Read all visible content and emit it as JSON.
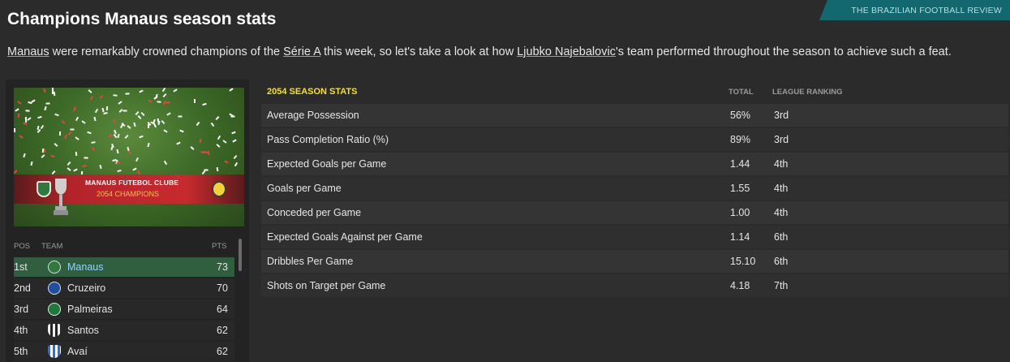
{
  "header": {
    "title": "Champions Manaus season stats",
    "source": "THE BRAZILIAN FOOTBALL REVIEW"
  },
  "intro": {
    "part1": "Manaus",
    "part2": " were remarkably crowned champions of the ",
    "part3": "Série A",
    "part4": " this week, so let's take a look at how ",
    "part5": "Ljubko Najebalovic",
    "part6": "'s team performed throughout the season to achieve such a feat."
  },
  "banner": {
    "club": "MANAUS FUTEBOL CLUBE",
    "subtitle": "2054 CHAMPIONS"
  },
  "standings": {
    "headers": {
      "pos": "POS",
      "team": "TEAM",
      "pts": "PTS"
    },
    "rows": [
      {
        "pos": "1st",
        "team": "Manaus",
        "pts": "73"
      },
      {
        "pos": "2nd",
        "team": "Cruzeiro",
        "pts": "70"
      },
      {
        "pos": "3rd",
        "team": "Palmeiras",
        "pts": "64"
      },
      {
        "pos": "4th",
        "team": "Santos",
        "pts": "62"
      },
      {
        "pos": "5th",
        "team": "Avaí",
        "pts": "62"
      }
    ]
  },
  "stats": {
    "title": "2054 SEASON STATS",
    "total_header": "TOTAL",
    "ranking_header": "LEAGUE RANKING",
    "rows": [
      {
        "label": "Average Possession",
        "total": "56%",
        "rank": "3rd"
      },
      {
        "label": "Pass Completion Ratio (%)",
        "total": "89%",
        "rank": "3rd"
      },
      {
        "label": "Expected Goals per Game",
        "total": "1.44",
        "rank": "4th"
      },
      {
        "label": "Goals per Game",
        "total": "1.55",
        "rank": "4th"
      },
      {
        "label": "Conceded per Game",
        "total": "1.00",
        "rank": "4th"
      },
      {
        "label": "Expected Goals Against per Game",
        "total": "1.14",
        "rank": "6th"
      },
      {
        "label": "Dribbles Per Game",
        "total": "15.10",
        "rank": "6th"
      },
      {
        "label": "Shots on Target per Game",
        "total": "4.18",
        "rank": "7th"
      }
    ]
  }
}
